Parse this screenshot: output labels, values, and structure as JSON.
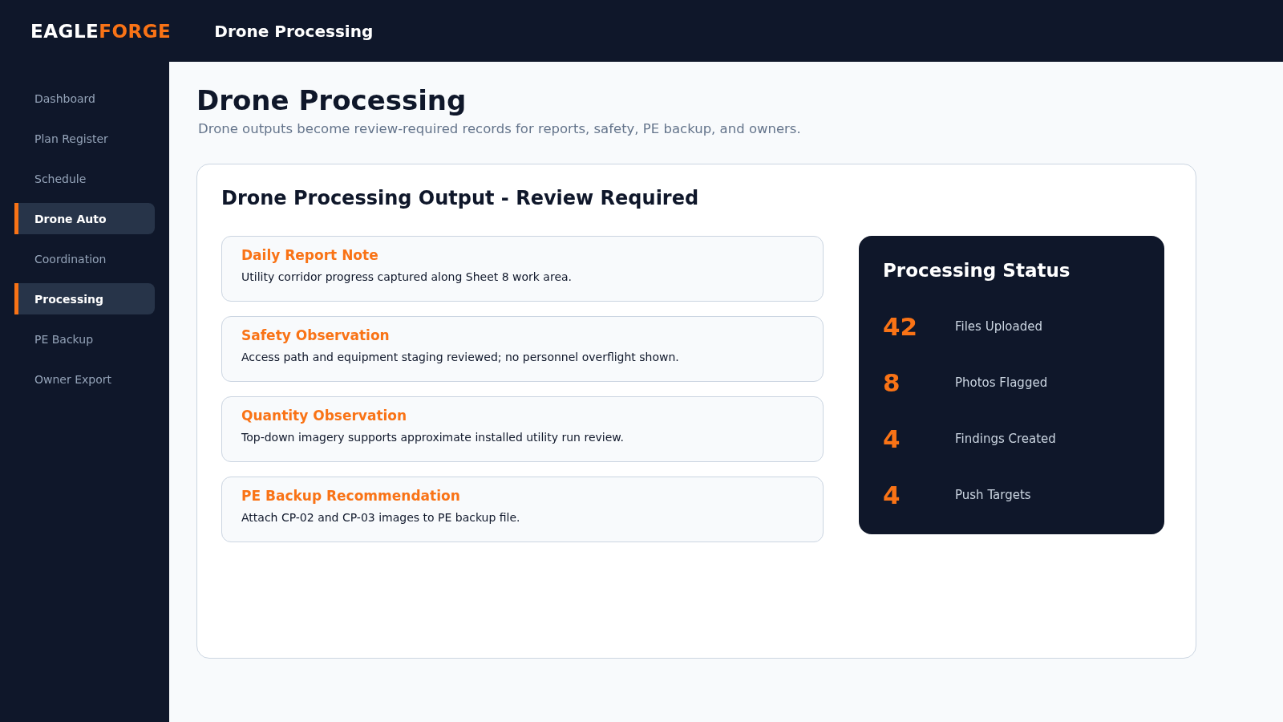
{
  "header": {
    "logo": {
      "text": "EAGLE",
      "accent": "FORGE"
    },
    "title": "Drone Processing"
  },
  "sidebar": {
    "items": [
      {
        "label": "Dashboard",
        "selected": false
      },
      {
        "label": "Plan Register",
        "selected": false
      },
      {
        "label": "Schedule",
        "selected": false
      },
      {
        "label": "Drone Auto",
        "selected": true
      },
      {
        "label": "Coordination",
        "selected": false
      },
      {
        "label": "Processing",
        "selected": true
      },
      {
        "label": "PE Backup",
        "selected": false
      },
      {
        "label": "Owner Export",
        "selected": false
      }
    ]
  },
  "page": {
    "title": "Drone Processing",
    "subtitle": "Drone outputs become review-required records for reports, safety, PE backup, and owners."
  },
  "card": {
    "title": "Drone Processing Output - Review Required",
    "outputs": [
      {
        "title": "Daily Report Note",
        "text": "Utility corridor progress captured along Sheet 8 work area."
      },
      {
        "title": "Safety Observation",
        "text": "Access path and equipment staging reviewed; no personnel overflight shown."
      },
      {
        "title": "Quantity Observation",
        "text": "Top-down imagery supports approximate installed utility run review."
      },
      {
        "title": "PE Backup Recommendation",
        "text": "Attach CP-02 and CP-03 images to PE backup file."
      }
    ],
    "status": {
      "title": "Processing Status",
      "stats": [
        {
          "value": "42",
          "label": "Files Uploaded"
        },
        {
          "value": "8",
          "label": "Photos Flagged"
        },
        {
          "value": "4",
          "label": "Findings Created"
        },
        {
          "value": "4",
          "label": "Push Targets"
        }
      ]
    }
  }
}
